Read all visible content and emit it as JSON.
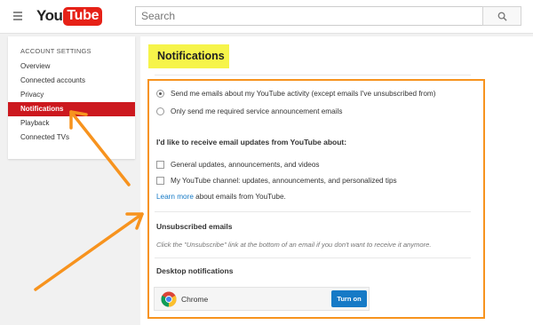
{
  "header": {
    "logo_you": "You",
    "logo_tube": "Tube",
    "search_placeholder": "Search"
  },
  "sidebar": {
    "heading": "ACCOUNT SETTINGS",
    "items": [
      {
        "label": "Overview",
        "active": false
      },
      {
        "label": "Connected accounts",
        "active": false
      },
      {
        "label": "Privacy",
        "active": false
      },
      {
        "label": "Notifications",
        "active": true
      },
      {
        "label": "Playback",
        "active": false
      },
      {
        "label": "Connected TVs",
        "active": false
      }
    ]
  },
  "main": {
    "title": "Notifications",
    "email_options": [
      {
        "label": "Send me emails about my YouTube activity (except emails I've unsubscribed from)",
        "checked": true
      },
      {
        "label": "Only send me required service announcement emails",
        "checked": false
      }
    ],
    "updates_heading": "I'd like to receive email updates from YouTube about:",
    "update_options": [
      {
        "label": "General updates, announcements, and videos",
        "checked": false
      },
      {
        "label": "My YouTube channel: updates, announcements, and personalized tips",
        "checked": false
      }
    ],
    "learn_more": {
      "link": "Learn more",
      "text": " about emails from YouTube."
    },
    "unsubscribed_heading": "Unsubscribed emails",
    "unsubscribed_note": "Click the \"Unsubscribe\" link at the bottom of an email if you don't want to receive it anymore.",
    "desktop_heading": "Desktop notifications",
    "desktop_browser": "Chrome",
    "turn_on_label": "Turn on"
  },
  "colors": {
    "highlight": "#f6f44a",
    "annotation": "#f7931e",
    "active_nav": "#cc181e",
    "link": "#167ac6"
  }
}
